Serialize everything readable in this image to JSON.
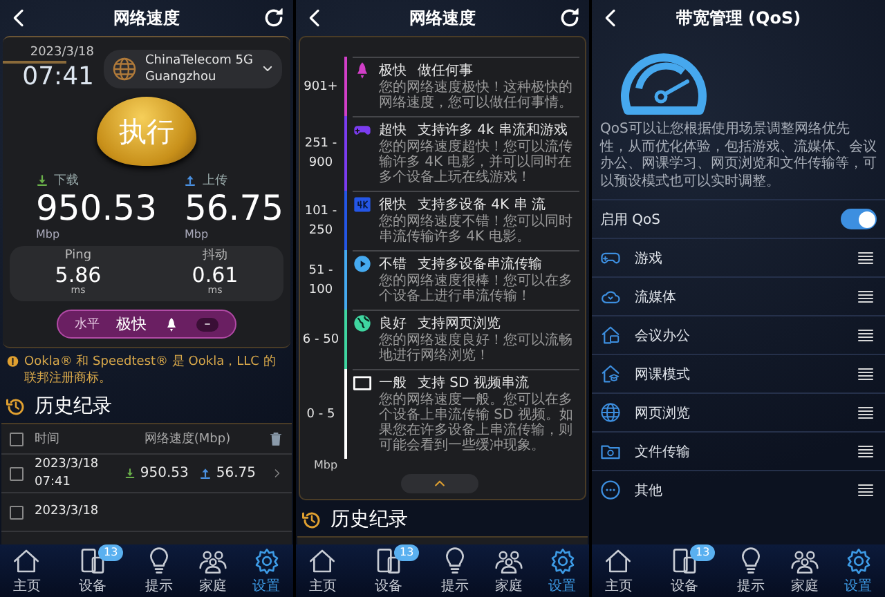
{
  "speed_test": {
    "header": {
      "title": "网络速度",
      "refresh": true
    },
    "date": "2023/3/18",
    "time": "07:41",
    "network": {
      "name": "ChinaTelecom 5G",
      "location": "Guangzhou"
    },
    "run_button": "执行",
    "download": {
      "label": "下载",
      "value": "950.53",
      "unit": "Mbp"
    },
    "upload": {
      "label": "上传",
      "value": "56.75",
      "unit": "Mbp"
    },
    "ping": {
      "label": "Ping",
      "value": "5.86",
      "unit": "ms"
    },
    "jitter": {
      "label": "抖动",
      "value": "0.61",
      "unit": "ms"
    },
    "level": {
      "label": "水平",
      "value": "极快",
      "indicator": "–"
    },
    "notice": "Ookla® 和 Speedtest® 是 Ookla，LLC 的联邦注册商标。",
    "history": {
      "title": "历史纪录",
      "all_checked": false,
      "columns": [
        "时间",
        "网络速度(Mbp)"
      ],
      "rows": [
        {
          "checked": false,
          "date": "2023/3/18",
          "clock": "07:41",
          "download": "950.53",
          "upload": "56.75"
        },
        {
          "checked": false,
          "date": "2023/3/18"
        }
      ]
    },
    "nav": [
      {
        "kind": "home",
        "label": "主页",
        "selected": false
      },
      {
        "kind": "devices",
        "label": "设备",
        "selected": false,
        "badge": "13"
      },
      {
        "kind": "tips",
        "label": "提示",
        "selected": false
      },
      {
        "kind": "family",
        "label": "家庭",
        "selected": false
      },
      {
        "kind": "settings",
        "label": "设置",
        "selected": true
      }
    ]
  },
  "speed_levels": {
    "header": {
      "title": "网络速度",
      "refresh": true
    },
    "levels": [
      {
        "kind": "rocket",
        "color": "#d23fc8",
        "range": "901+",
        "label": "极快",
        "title": "做任何事",
        "description": "您的网络速度极快！这种极快的网络速度，您可以做任何事情。"
      },
      {
        "kind": "gamepad",
        "color": "#7b3cf0",
        "range": "251 - 900",
        "label": "超快",
        "title": "支持许多 4k 串流和游戏",
        "description": "您的网络速度超快！您可以流传输许多 4K 电影，并可以同时在多个设备上玩在线游戏！"
      },
      {
        "kind": "tile",
        "color": "#2456e6",
        "range": "101 - 250",
        "label": "很快",
        "title": "支持多设备 4K 串 流",
        "description": "您的网络速度不错！您可以同时串流传输许多 4K 电影。"
      },
      {
        "kind": "play",
        "color": "#45aaf0",
        "range": "51 - 100",
        "label": "不错",
        "title": "支持多设备串流传输",
        "description": "您的网络速度很棒！您可以在多个设备上进行串流传输！"
      },
      {
        "kind": "globe",
        "color": "#3fd6a0",
        "range": "6 - 50",
        "label": "良好",
        "title": "支持网页浏览",
        "description": "您的网络速度良好！您可以流畅地进行网络浏览！"
      },
      {
        "kind": "screen",
        "color": "#ffffff",
        "range": "0 - 5",
        "label": "一般",
        "title": "支持 SD 视频串流",
        "description": "您的网络速度一般。您可以在多个设备上串流传输 SD 视频。如果您在许多设备上串流传输，则可能会看到一些缓冲现象。"
      }
    ],
    "scale_unit": "Mbp",
    "history_title": "历史纪录",
    "nav": [
      {
        "kind": "home",
        "label": "主页",
        "selected": false
      },
      {
        "kind": "devices",
        "label": "设备",
        "selected": false,
        "badge": "13"
      },
      {
        "kind": "tips",
        "label": "提示",
        "selected": false
      },
      {
        "kind": "family",
        "label": "家庭",
        "selected": false
      },
      {
        "kind": "settings",
        "label": "设置",
        "selected": true
      }
    ]
  },
  "qos": {
    "header": {
      "title": "带宽管理 (QoS)",
      "refresh": false
    },
    "description": "QoS可以让您根据使用场景调整网络优先性，从而优化体验，包括游戏、流媒体、会议办公、网课学习、网页浏览和文件传输等，可以预设模式也可以实时调整。",
    "enable": {
      "label": "启用 QoS",
      "on": true
    },
    "categories": [
      {
        "kind": "gamepad",
        "label": "游戏"
      },
      {
        "kind": "cloud",
        "label": "流媒体"
      },
      {
        "kind": "office",
        "label": "会议办公"
      },
      {
        "kind": "classroom",
        "label": "网课模式"
      },
      {
        "kind": "globe",
        "label": "网页浏览"
      },
      {
        "kind": "folder",
        "label": "文件传输"
      },
      {
        "kind": "dots",
        "label": "其他"
      }
    ],
    "nav": [
      {
        "kind": "home",
        "label": "主页",
        "selected": false
      },
      {
        "kind": "devices",
        "label": "设备",
        "selected": false,
        "badge": "13"
      },
      {
        "kind": "tips",
        "label": "提示",
        "selected": false
      },
      {
        "kind": "family",
        "label": "家庭",
        "selected": false
      },
      {
        "kind": "settings",
        "label": "设置",
        "selected": true
      }
    ]
  }
}
